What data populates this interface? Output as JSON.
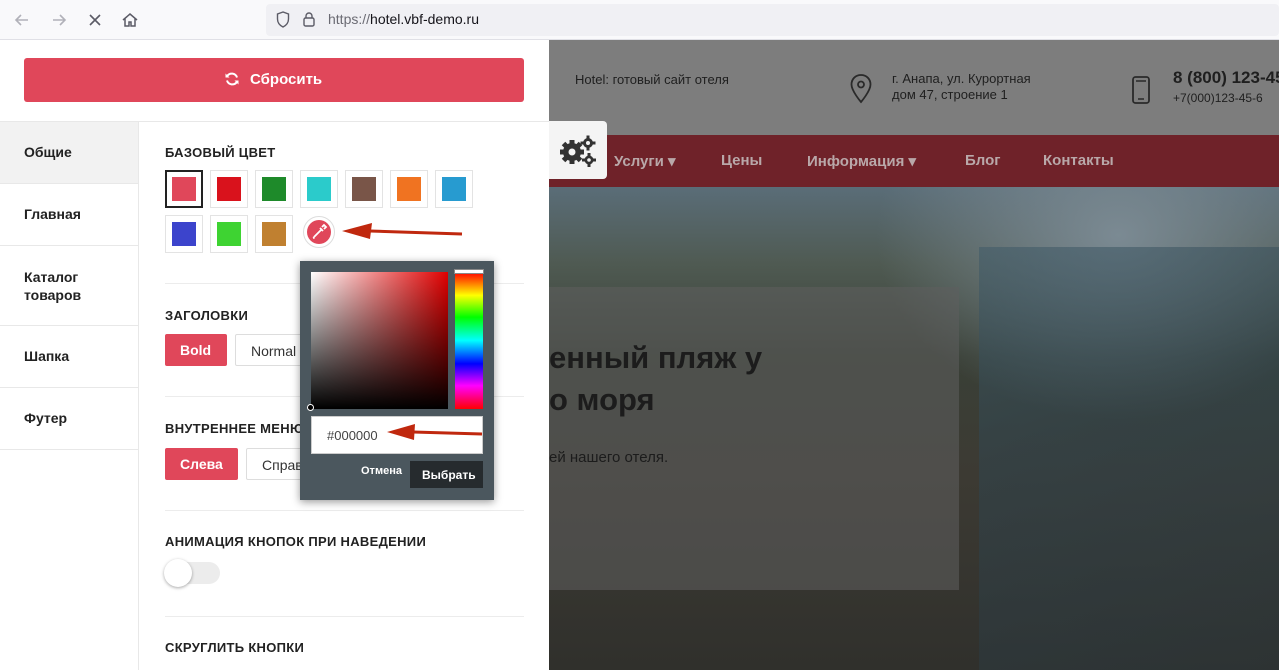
{
  "browser": {
    "url_proto": "https://",
    "url_host": "hotel.vbf-demo.ru"
  },
  "site": {
    "tagline": "Hotel: готовый сайт отеля",
    "address_line1": "г. Анапа, ул. Курортная",
    "address_line2": "дом 47, строение 1",
    "phone1": "8 (800) 123-45",
    "phone2": "+7(000)123-45-6",
    "nav": [
      "Услуги",
      "Цены",
      "Информация",
      "Блог",
      "Контакты"
    ],
    "hero_title_line1": "енный пляж у",
    "hero_title_line2": "о моря",
    "hero_subtitle": "ей нашего отеля."
  },
  "panel": {
    "reset_label": "Сбросить",
    "tabs": [
      "Общие",
      "Главная",
      "Каталог товаров",
      "Шапка",
      "Футер"
    ],
    "active_tab": "Общие",
    "base_color": {
      "title": "БАЗОВЫЙ ЦВЕТ",
      "swatches": [
        "#e0475a",
        "#d9121c",
        "#1e8a2a",
        "#2bcbcb",
        "#795548",
        "#f07321",
        "#279bd0",
        "#3c44cc",
        "#3ed332",
        "#c08030"
      ],
      "selected": "#e0475a"
    },
    "headings": {
      "title": "ЗАГОЛОВКИ",
      "options": [
        "Bold",
        "Normal"
      ],
      "selected": "Bold"
    },
    "inner_menu": {
      "title": "ВНУТРЕННЕЕ МЕНЮ",
      "options": [
        "Слева",
        "Справа"
      ],
      "selected": "Слева"
    },
    "button_animation": {
      "title": "АНИМАЦИЯ КНОПОК ПРИ НАВЕДЕНИИ",
      "enabled": false
    },
    "round_buttons": {
      "title": "СКРУГЛИТЬ КНОПКИ"
    }
  },
  "color_picker": {
    "value": "#000000",
    "cancel_label": "Отмена",
    "choose_label": "Выбрать"
  },
  "colors": {
    "accent": "#e0475a",
    "annotation_arrow": "#c0280e"
  }
}
